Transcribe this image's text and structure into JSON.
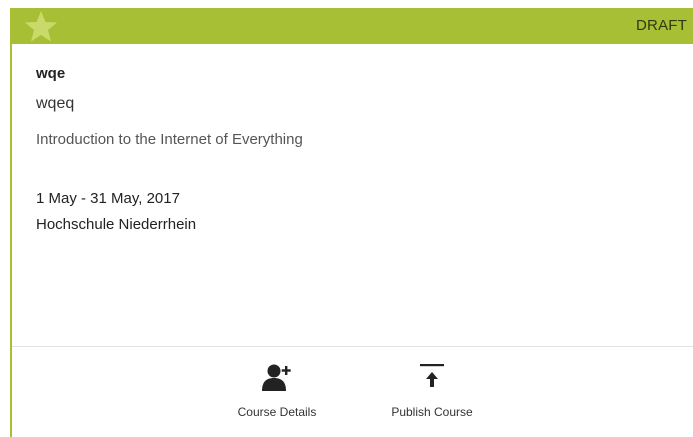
{
  "card": {
    "status": "DRAFT",
    "code": "wqe",
    "title": "wqeq",
    "subtitle": "Introduction to the Internet of Everything",
    "dates": "1 May - 31 May, 2017",
    "institution": "Hochschule Niederrhein"
  },
  "actions": {
    "details_label": "Course Details",
    "publish_label": "Publish Course"
  },
  "icons": {
    "favorite": "star-icon",
    "details": "add-user-icon",
    "publish": "upload-icon"
  },
  "colors": {
    "accent": "#a7bf35",
    "star": "#c9d96a"
  }
}
